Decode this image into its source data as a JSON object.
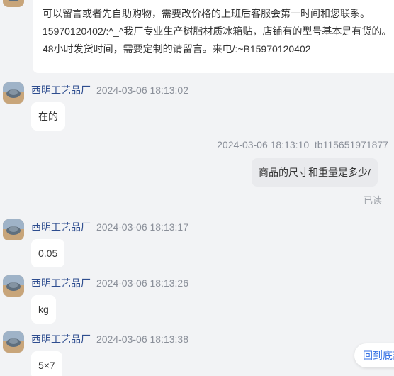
{
  "shop": {
    "name": "西明工艺品厂"
  },
  "messages": [
    {
      "from": "shop",
      "text": "可以留言或者先自助购物，需要改价格的上班后客服会第一时间和您联系。15970120402/:^_^我厂专业生产树脂材质冰箱贴，店铺有的型号基本是有货的。48小时发货时间，需要定制的请留言。来电/:~B15970120402"
    },
    {
      "from": "shop",
      "time": "2024-03-06 18:13:02",
      "text": "在的"
    },
    {
      "from": "buyer",
      "time": "2024-03-06 18:13:10",
      "user": "tb115651971877",
      "text": "商品的尺寸和重量是多少/",
      "status": "已读"
    },
    {
      "from": "shop",
      "time": "2024-03-06 18:13:17",
      "text": "0.05"
    },
    {
      "from": "shop",
      "time": "2024-03-06 18:13:26",
      "text": "kg"
    },
    {
      "from": "shop",
      "time": "2024-03-06 18:13:38",
      "text": "5×7"
    }
  ],
  "back_to_bottom": "回到底部",
  "colors": {
    "background": "#f2f3f5",
    "bubble": "#ffffff",
    "self_bubble": "#e9eaed",
    "sender_name": "#2e4d8f",
    "link": "#3470e4"
  }
}
